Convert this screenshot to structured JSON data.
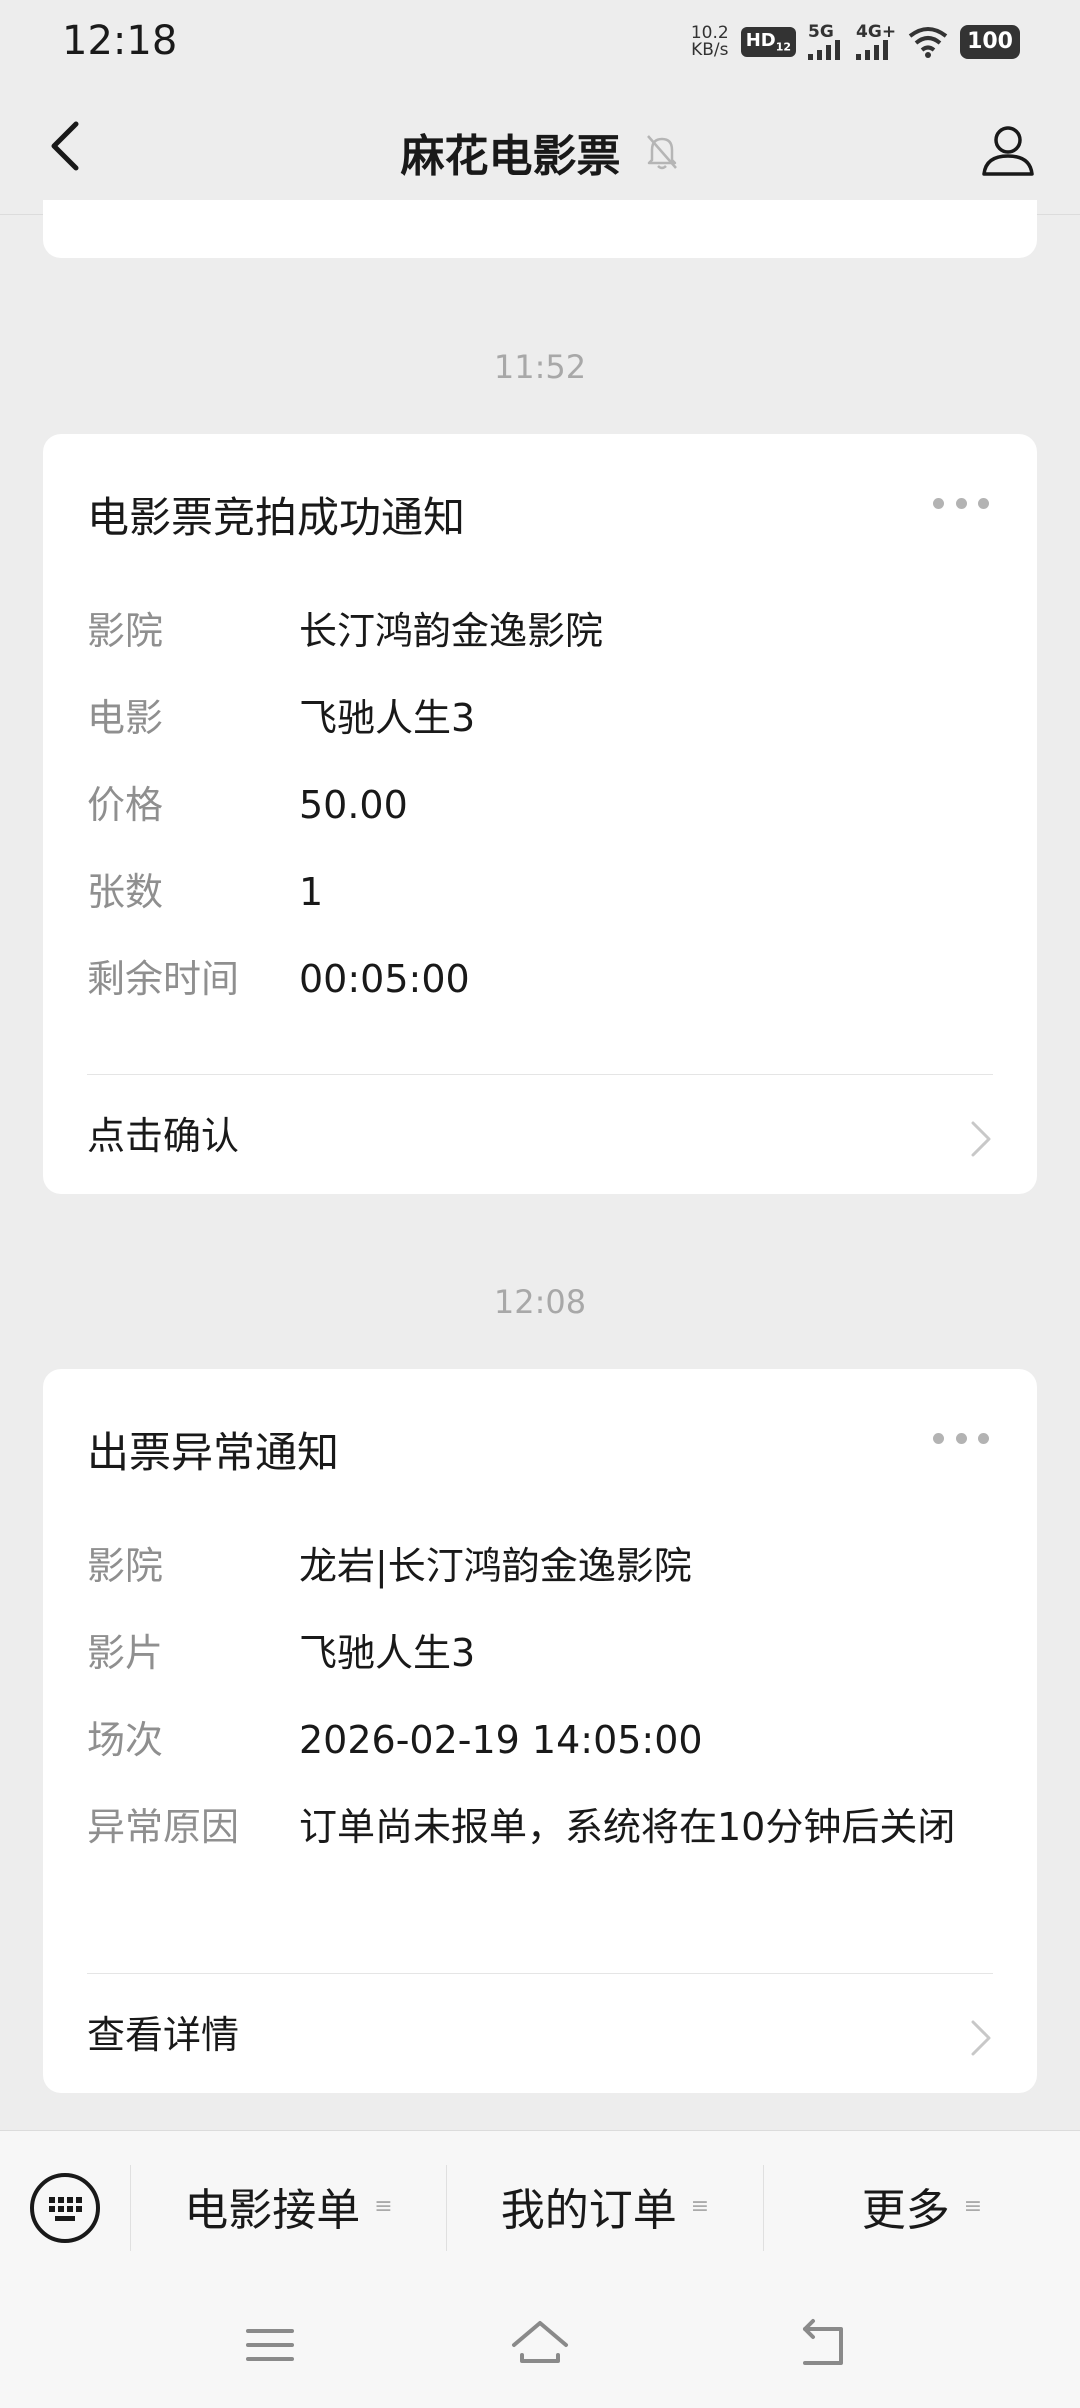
{
  "status_bar": {
    "time": "12:18",
    "net_speed_value": "10.2",
    "net_speed_unit": "KB/s",
    "hd_label": "HD",
    "hd_sub": "12",
    "signal_5g": "5G",
    "signal_4g": "4G+",
    "battery": "100"
  },
  "header": {
    "title": "麻花电影票",
    "back_icon": "chevron-left-icon",
    "mute_icon": "bell-off-icon",
    "profile_icon": "user-icon"
  },
  "messages": [
    {
      "time": "11:52",
      "title": "电影票竞拍成功通知",
      "fields": [
        {
          "label": "影院",
          "value": "长汀鸿韵金逸影院"
        },
        {
          "label": "电影",
          "value": "飞驰人生3"
        },
        {
          "label": "价格",
          "value": "50.00"
        },
        {
          "label": "张数",
          "value": "1"
        },
        {
          "label": "剩余时间",
          "value": "00:05:00"
        }
      ],
      "action": "点击确认"
    },
    {
      "time": "12:08",
      "title": "出票异常通知",
      "fields": [
        {
          "label": "影院",
          "value": "龙岩|长汀鸿韵金逸影院"
        },
        {
          "label": "影片",
          "value": "飞驰人生3"
        },
        {
          "label": "场次",
          "value": "2026-02-19 14:05:00"
        },
        {
          "label": "异常原因",
          "value": "订单尚未报单，系统将在10分钟后关闭"
        }
      ],
      "action": "查看详情"
    }
  ],
  "bottom_menu": {
    "keyboard_icon": "keyboard-icon",
    "items": [
      {
        "label": "电影接单"
      },
      {
        "label": "我的订单"
      },
      {
        "label": "更多"
      }
    ],
    "mark": "≡"
  },
  "nav_bar": {
    "menu_icon": "menu-icon",
    "home_icon": "home-icon",
    "back_icon": "back-icon"
  }
}
